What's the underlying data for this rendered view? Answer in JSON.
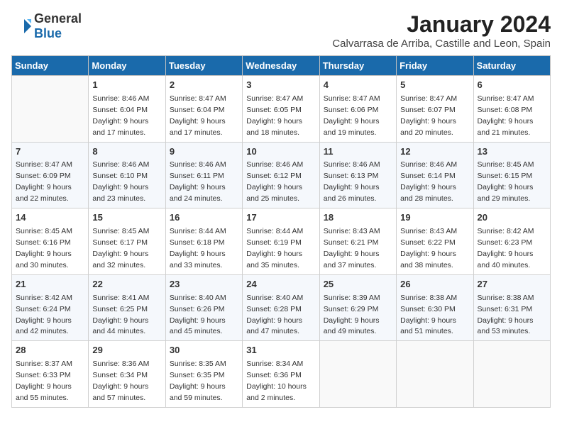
{
  "header": {
    "logo_general": "General",
    "logo_blue": "Blue",
    "main_title": "January 2024",
    "sub_title": "Calvarrasa de Arriba, Castille and Leon, Spain"
  },
  "days_of_week": [
    "Sunday",
    "Monday",
    "Tuesday",
    "Wednesday",
    "Thursday",
    "Friday",
    "Saturday"
  ],
  "weeks": [
    [
      {
        "day": "",
        "empty": true
      },
      {
        "day": "1",
        "sunrise": "Sunrise: 8:46 AM",
        "sunset": "Sunset: 6:04 PM",
        "daylight": "Daylight: 9 hours and 17 minutes."
      },
      {
        "day": "2",
        "sunrise": "Sunrise: 8:47 AM",
        "sunset": "Sunset: 6:04 PM",
        "daylight": "Daylight: 9 hours and 17 minutes."
      },
      {
        "day": "3",
        "sunrise": "Sunrise: 8:47 AM",
        "sunset": "Sunset: 6:05 PM",
        "daylight": "Daylight: 9 hours and 18 minutes."
      },
      {
        "day": "4",
        "sunrise": "Sunrise: 8:47 AM",
        "sunset": "Sunset: 6:06 PM",
        "daylight": "Daylight: 9 hours and 19 minutes."
      },
      {
        "day": "5",
        "sunrise": "Sunrise: 8:47 AM",
        "sunset": "Sunset: 6:07 PM",
        "daylight": "Daylight: 9 hours and 20 minutes."
      },
      {
        "day": "6",
        "sunrise": "Sunrise: 8:47 AM",
        "sunset": "Sunset: 6:08 PM",
        "daylight": "Daylight: 9 hours and 21 minutes."
      }
    ],
    [
      {
        "day": "7",
        "sunrise": "Sunrise: 8:47 AM",
        "sunset": "Sunset: 6:09 PM",
        "daylight": "Daylight: 9 hours and 22 minutes."
      },
      {
        "day": "8",
        "sunrise": "Sunrise: 8:46 AM",
        "sunset": "Sunset: 6:10 PM",
        "daylight": "Daylight: 9 hours and 23 minutes."
      },
      {
        "day": "9",
        "sunrise": "Sunrise: 8:46 AM",
        "sunset": "Sunset: 6:11 PM",
        "daylight": "Daylight: 9 hours and 24 minutes."
      },
      {
        "day": "10",
        "sunrise": "Sunrise: 8:46 AM",
        "sunset": "Sunset: 6:12 PM",
        "daylight": "Daylight: 9 hours and 25 minutes."
      },
      {
        "day": "11",
        "sunrise": "Sunrise: 8:46 AM",
        "sunset": "Sunset: 6:13 PM",
        "daylight": "Daylight: 9 hours and 26 minutes."
      },
      {
        "day": "12",
        "sunrise": "Sunrise: 8:46 AM",
        "sunset": "Sunset: 6:14 PM",
        "daylight": "Daylight: 9 hours and 28 minutes."
      },
      {
        "day": "13",
        "sunrise": "Sunrise: 8:45 AM",
        "sunset": "Sunset: 6:15 PM",
        "daylight": "Daylight: 9 hours and 29 minutes."
      }
    ],
    [
      {
        "day": "14",
        "sunrise": "Sunrise: 8:45 AM",
        "sunset": "Sunset: 6:16 PM",
        "daylight": "Daylight: 9 hours and 30 minutes."
      },
      {
        "day": "15",
        "sunrise": "Sunrise: 8:45 AM",
        "sunset": "Sunset: 6:17 PM",
        "daylight": "Daylight: 9 hours and 32 minutes."
      },
      {
        "day": "16",
        "sunrise": "Sunrise: 8:44 AM",
        "sunset": "Sunset: 6:18 PM",
        "daylight": "Daylight: 9 hours and 33 minutes."
      },
      {
        "day": "17",
        "sunrise": "Sunrise: 8:44 AM",
        "sunset": "Sunset: 6:19 PM",
        "daylight": "Daylight: 9 hours and 35 minutes."
      },
      {
        "day": "18",
        "sunrise": "Sunrise: 8:43 AM",
        "sunset": "Sunset: 6:21 PM",
        "daylight": "Daylight: 9 hours and 37 minutes."
      },
      {
        "day": "19",
        "sunrise": "Sunrise: 8:43 AM",
        "sunset": "Sunset: 6:22 PM",
        "daylight": "Daylight: 9 hours and 38 minutes."
      },
      {
        "day": "20",
        "sunrise": "Sunrise: 8:42 AM",
        "sunset": "Sunset: 6:23 PM",
        "daylight": "Daylight: 9 hours and 40 minutes."
      }
    ],
    [
      {
        "day": "21",
        "sunrise": "Sunrise: 8:42 AM",
        "sunset": "Sunset: 6:24 PM",
        "daylight": "Daylight: 9 hours and 42 minutes."
      },
      {
        "day": "22",
        "sunrise": "Sunrise: 8:41 AM",
        "sunset": "Sunset: 6:25 PM",
        "daylight": "Daylight: 9 hours and 44 minutes."
      },
      {
        "day": "23",
        "sunrise": "Sunrise: 8:40 AM",
        "sunset": "Sunset: 6:26 PM",
        "daylight": "Daylight: 9 hours and 45 minutes."
      },
      {
        "day": "24",
        "sunrise": "Sunrise: 8:40 AM",
        "sunset": "Sunset: 6:28 PM",
        "daylight": "Daylight: 9 hours and 47 minutes."
      },
      {
        "day": "25",
        "sunrise": "Sunrise: 8:39 AM",
        "sunset": "Sunset: 6:29 PM",
        "daylight": "Daylight: 9 hours and 49 minutes."
      },
      {
        "day": "26",
        "sunrise": "Sunrise: 8:38 AM",
        "sunset": "Sunset: 6:30 PM",
        "daylight": "Daylight: 9 hours and 51 minutes."
      },
      {
        "day": "27",
        "sunrise": "Sunrise: 8:38 AM",
        "sunset": "Sunset: 6:31 PM",
        "daylight": "Daylight: 9 hours and 53 minutes."
      }
    ],
    [
      {
        "day": "28",
        "sunrise": "Sunrise: 8:37 AM",
        "sunset": "Sunset: 6:33 PM",
        "daylight": "Daylight: 9 hours and 55 minutes."
      },
      {
        "day": "29",
        "sunrise": "Sunrise: 8:36 AM",
        "sunset": "Sunset: 6:34 PM",
        "daylight": "Daylight: 9 hours and 57 minutes."
      },
      {
        "day": "30",
        "sunrise": "Sunrise: 8:35 AM",
        "sunset": "Sunset: 6:35 PM",
        "daylight": "Daylight: 9 hours and 59 minutes."
      },
      {
        "day": "31",
        "sunrise": "Sunrise: 8:34 AM",
        "sunset": "Sunset: 6:36 PM",
        "daylight": "Daylight: 10 hours and 2 minutes."
      },
      {
        "day": "",
        "empty": true
      },
      {
        "day": "",
        "empty": true
      },
      {
        "day": "",
        "empty": true
      }
    ]
  ]
}
